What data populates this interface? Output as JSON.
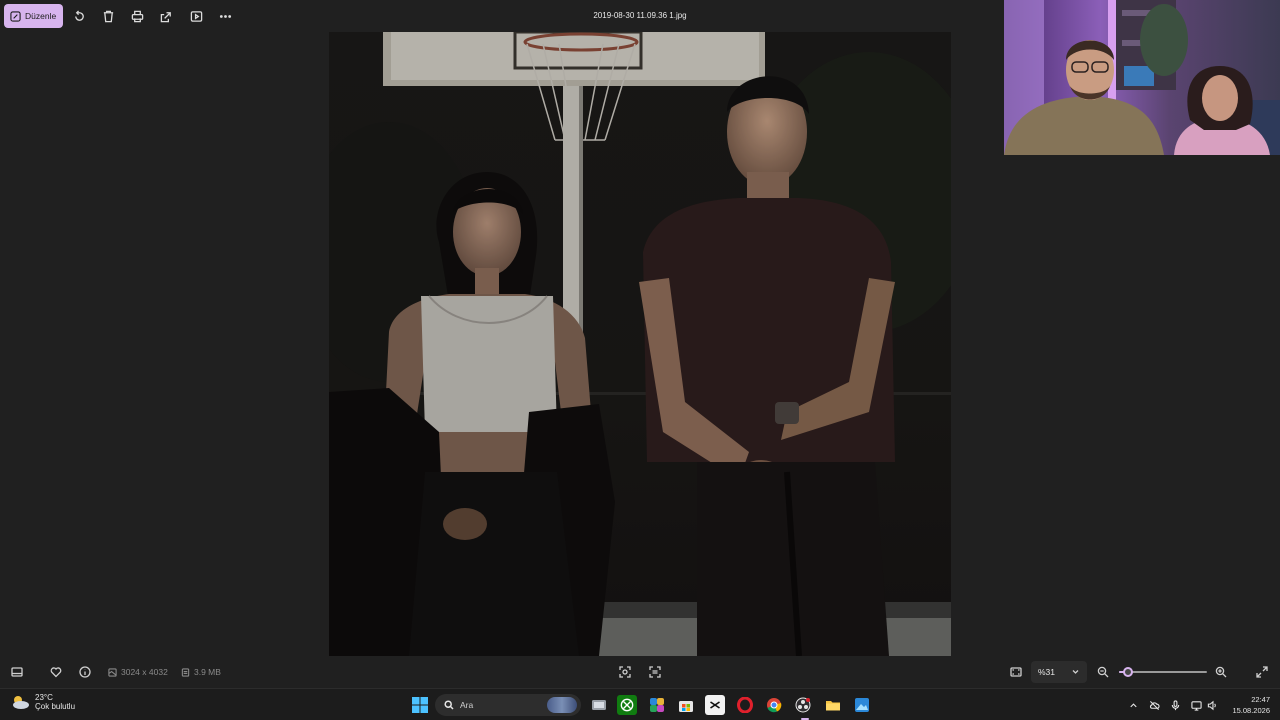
{
  "toolbar": {
    "edit_label": "Düzenle",
    "filename": "2019-08-30 11.09.36 1.jpg",
    "icons": [
      "rotate-icon",
      "delete-icon",
      "print-icon",
      "share-icon",
      "slideshow-icon",
      "more-icon"
    ]
  },
  "bottombar": {
    "dimensions": "3024 x 4032",
    "filesize": "3.9 MB",
    "zoom_value": "%31",
    "zoom_slider_level": 0.1
  },
  "taskbar": {
    "temperature": "23°C",
    "weather_desc": "Çok bulutlu",
    "search_placeholder": "Ara",
    "time": "22:47",
    "date": "15.08.2026"
  },
  "colors": {
    "accent": "#d7b4ee",
    "background": "#202020",
    "taskbar": "#1c1c1c"
  }
}
